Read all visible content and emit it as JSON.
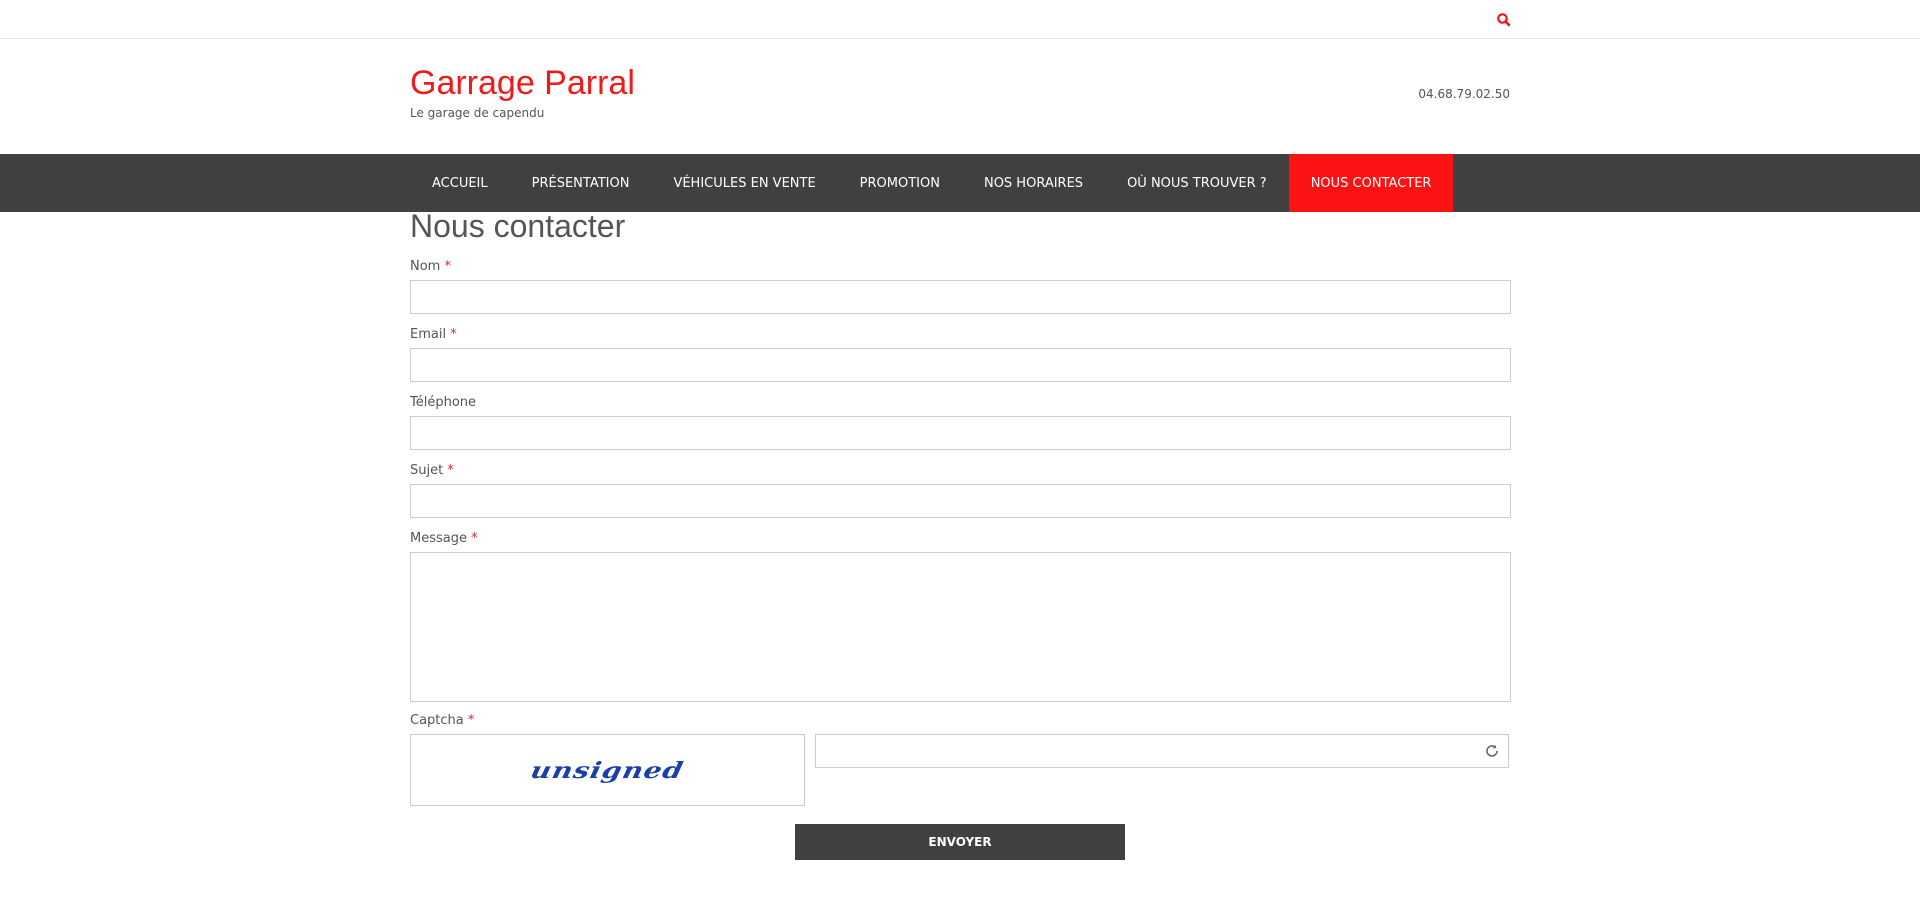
{
  "header": {
    "site_title": "Garrage Parral",
    "tagline": "Le garage de capendu",
    "phone": "04.68.79.02.50"
  },
  "nav": {
    "items": [
      {
        "label": "ACCUEIL"
      },
      {
        "label": "PRÉSENTATION"
      },
      {
        "label": "VÉHICULES EN VENTE"
      },
      {
        "label": "PROMOTION"
      },
      {
        "label": "NOS HORAIRES"
      },
      {
        "label": "OÙ NOUS TROUVER ?"
      },
      {
        "label": "NOUS CONTACTER"
      }
    ],
    "active_index": 6
  },
  "page": {
    "title": "Nous contacter"
  },
  "form": {
    "name_label": "Nom",
    "email_label": "Email",
    "phone_label": "Téléphone",
    "subject_label": "Sujet",
    "message_label": "Message",
    "captcha_label": "Captcha",
    "required_mark": "*",
    "name_value": "",
    "email_value": "",
    "phone_value": "",
    "subject_value": "",
    "message_value": "",
    "captcha_value": "",
    "captcha_image_text": "unsigned",
    "submit_label": "ENVOYER"
  },
  "icons": {
    "search": "search-icon",
    "refresh": "refresh-icon"
  },
  "colors": {
    "accent": "#fb1212",
    "nav_bg": "#404040",
    "title_red": "#f11a1a",
    "captcha_blue": "#1a3fa8"
  }
}
